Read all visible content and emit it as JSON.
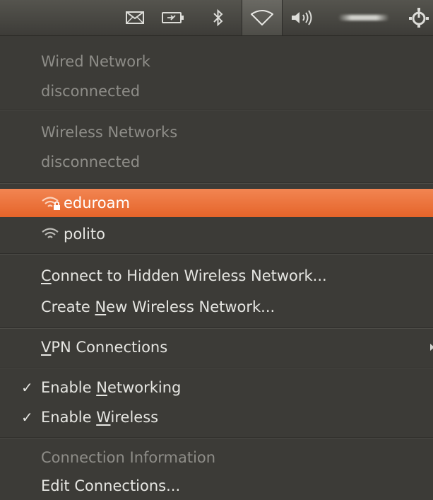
{
  "panel": {
    "indicators": [
      {
        "name": "mail-icon"
      },
      {
        "name": "battery-icon"
      },
      {
        "name": "bluetooth-icon"
      },
      {
        "name": "wifi-icon",
        "active": true
      },
      {
        "name": "volume-icon"
      },
      {
        "name": "power-gear-icon"
      }
    ],
    "user_name_blurred": true
  },
  "menu": {
    "wired_header": "Wired Network",
    "wired_status": "disconnected",
    "wireless_header": "Wireless Networks",
    "wireless_status": "disconnected",
    "networks": [
      {
        "name": "eduroam",
        "highlighted": true,
        "secured": true
      },
      {
        "name": "polito",
        "highlighted": false,
        "secured": false
      }
    ],
    "connect_hidden": {
      "mnemonic": "C",
      "rest": "onnect to Hidden Wireless Network..."
    },
    "create_new": {
      "before": "Create ",
      "mnemonic": "N",
      "rest": "ew Wireless Network..."
    },
    "vpn": {
      "mnemonic": "V",
      "rest": "PN Connections"
    },
    "enable_networking": {
      "before": "Enable ",
      "mnemonic": "N",
      "rest": "etworking",
      "checked": true
    },
    "enable_wireless": {
      "before": "Enable ",
      "mnemonic": "W",
      "rest": "ireless",
      "checked": true
    },
    "connection_information": "Connection Information",
    "edit_connections": "Edit Connections..."
  },
  "colors": {
    "highlight": "#f07746",
    "menu_bg": "#3c3b37",
    "text": "#e6e6e2",
    "text_dim": "#8e8d88"
  },
  "glyphs": {
    "check": "✓"
  }
}
